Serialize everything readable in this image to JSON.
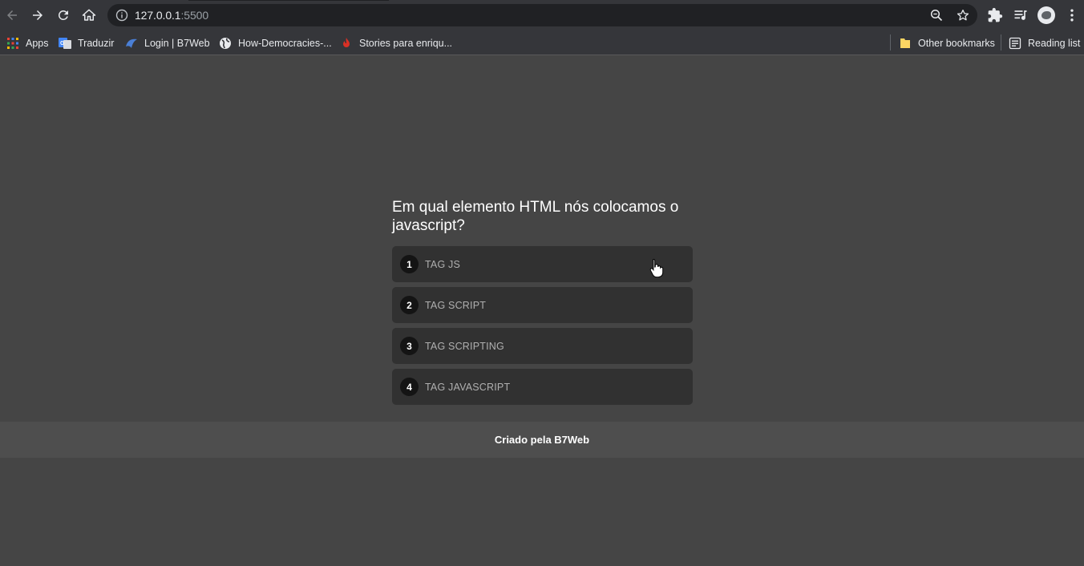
{
  "browser": {
    "url_host": "127.0.0.1",
    "url_port": ":5500",
    "bookmarks": [
      {
        "label": "Apps",
        "icon": "apps-grid-icon"
      },
      {
        "label": "Traduzir",
        "icon": "google-translate-icon"
      },
      {
        "label": "Login | B7Web",
        "icon": "b7web-icon"
      },
      {
        "label": "How-Democracies-...",
        "icon": "globe-icon"
      },
      {
        "label": "Stories para enriqu...",
        "icon": "flame-icon"
      }
    ],
    "other_bookmarks": "Other bookmarks",
    "reading_list": "Reading list"
  },
  "quiz": {
    "question": "Em qual elemento HTML nós colocamos o javascript?",
    "options": [
      {
        "number": "1",
        "label": "TAG JS"
      },
      {
        "number": "2",
        "label": "TAG SCRIPT"
      },
      {
        "number": "3",
        "label": "TAG SCRIPTING"
      },
      {
        "number": "4",
        "label": "TAG JAVASCRIPT"
      }
    ]
  },
  "footer": {
    "text": "Criado pela B7Web"
  },
  "colors": {
    "page_bg": "#454545",
    "option_bg": "#313131",
    "number_bg": "#141414",
    "footer_bg": "#4e4e4e"
  }
}
